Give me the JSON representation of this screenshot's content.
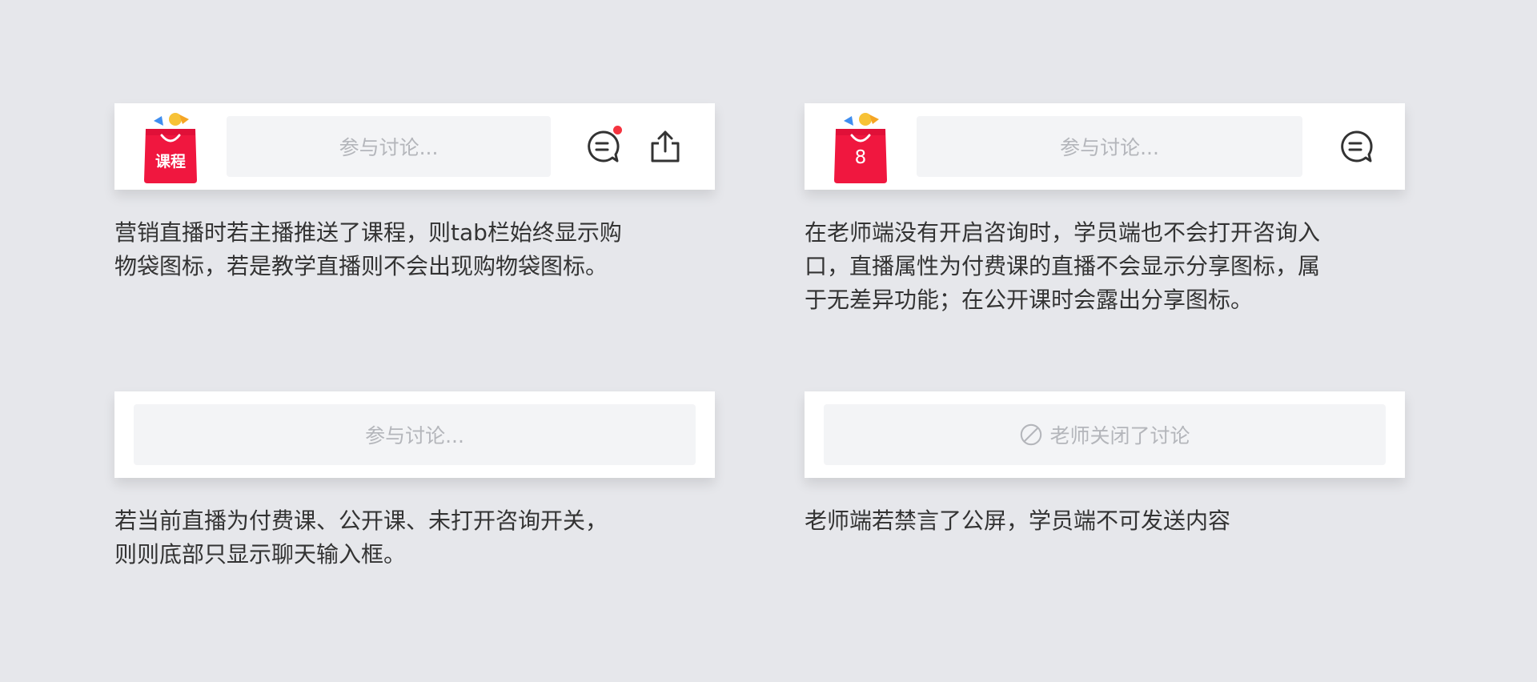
{
  "colors": {
    "background": "#e6e7eb",
    "bag_red": "#f0173f",
    "badge": "#f5333f",
    "placeholder": "#b4b6bb",
    "text": "#333333"
  },
  "panel1": {
    "bag_label": "课程",
    "placeholder": "参与讨论...",
    "icons": [
      "bag-icon",
      "chat-icon",
      "notification-dot",
      "share-icon"
    ],
    "desc": [
      "营销直播时若主播推送了课程，则tab栏始终显示购",
      "物袋图标，若是教学直播则不会出现购物袋图标。"
    ]
  },
  "panel2": {
    "bag_label": "8",
    "placeholder": "参与讨论...",
    "icons": [
      "bag-icon",
      "chat-icon"
    ],
    "desc": [
      "在老师端没有开启咨询时，学员端也不会打开咨询入",
      "口，直播属性为付费课的直播不会显示分享图标，属",
      "于无差异功能；在公开课时会露出分享图标。"
    ]
  },
  "panel3": {
    "placeholder": "参与讨论...",
    "desc": [
      "若当前直播为付费课、公开课、未打开咨询开关，",
      "则则底部只显示聊天输入框。"
    ]
  },
  "panel4": {
    "placeholder": "老师关闭了讨论",
    "icons": [
      "disabled-icon"
    ],
    "desc": [
      "老师端若禁言了公屏，学员端不可发送内容"
    ]
  }
}
